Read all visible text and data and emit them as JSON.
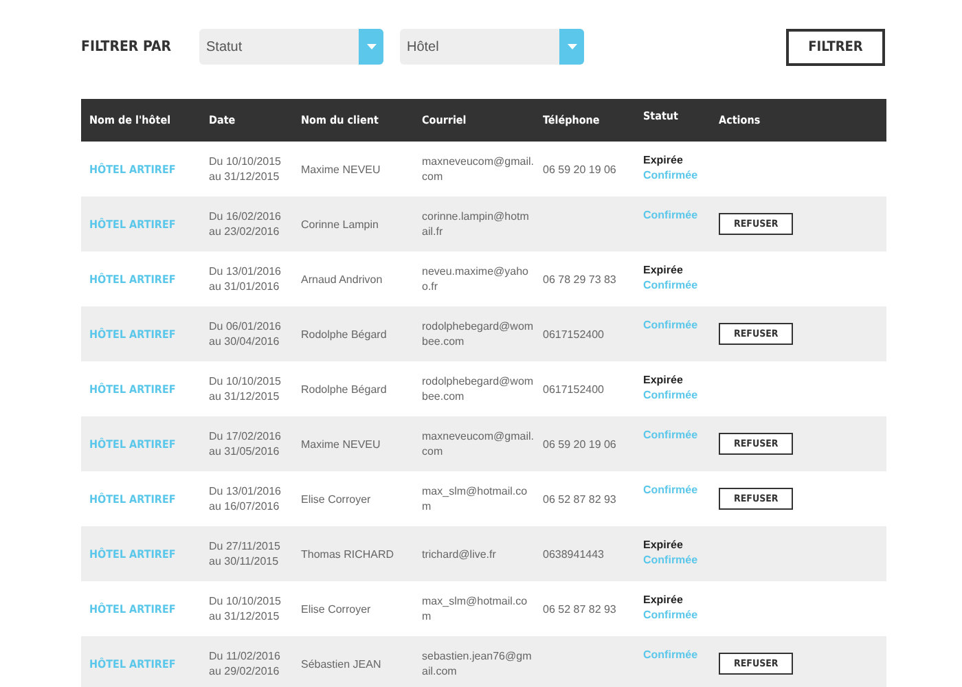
{
  "filter_bar": {
    "label": "FILTRER PAR",
    "selects": [
      {
        "placeholder": "Statut"
      },
      {
        "placeholder": "Hôtel"
      }
    ],
    "button": "FILTRER"
  },
  "table": {
    "columns": [
      "Nom de l'hôtel",
      "Date",
      "Nom du client",
      "Courriel",
      "Téléphone",
      "Statut",
      "Actions"
    ],
    "rows": [
      {
        "hotel": "HÔTEL ARTIREF",
        "date_from": "Du 10/10/2015",
        "date_to": "au 31/12/2015",
        "client": "Maxime NEVEU",
        "email": "maxneveucom@gmail.com",
        "phone": "06 59 20 19 06",
        "statuses": [
          {
            "label": "Expirée",
            "kind": "expired"
          },
          {
            "label": "Confirmée",
            "kind": "confirmed"
          }
        ]
      },
      {
        "hotel": "HÔTEL ARTIREF",
        "date_from": "Du 16/02/2016",
        "date_to": "au 23/02/2016",
        "client": "Corinne Lampin",
        "email": "corinne.lampin@hotmail.fr",
        "statuses": [
          {
            "label": "Confirmée",
            "kind": "confirmed"
          }
        ],
        "action": "REFUSER"
      },
      {
        "hotel": "HÔTEL ARTIREF",
        "date_from": "Du 13/01/2016",
        "date_to": "au 31/01/2016",
        "client": "Arnaud Andrivon",
        "email": "neveu.maxime@yahoo.fr",
        "phone": "06 78 29 73 83",
        "statuses": [
          {
            "label": "Expirée",
            "kind": "expired"
          },
          {
            "label": "Confirmée",
            "kind": "confirmed"
          }
        ]
      },
      {
        "hotel": "HÔTEL ARTIREF",
        "date_from": "Du 06/01/2016",
        "date_to": "au 30/04/2016",
        "client": "Rodolphe Bégard",
        "email": "rodolphebegard@wombee.com",
        "phone": "0617152400",
        "statuses": [
          {
            "label": "Confirmée",
            "kind": "confirmed"
          }
        ],
        "action": "REFUSER"
      },
      {
        "hotel": "HÔTEL ARTIREF",
        "date_from": "Du 10/10/2015",
        "date_to": "au 31/12/2015",
        "client": "Rodolphe Bégard",
        "email": "rodolphebegard@wombee.com",
        "phone": "0617152400",
        "statuses": [
          {
            "label": "Expirée",
            "kind": "expired"
          },
          {
            "label": "Confirmée",
            "kind": "confirmed"
          }
        ]
      },
      {
        "hotel": "HÔTEL ARTIREF",
        "date_from": "Du 17/02/2016",
        "date_to": "au 31/05/2016",
        "client": "Maxime NEVEU",
        "email": "maxneveucom@gmail.com",
        "phone": "06 59 20 19 06",
        "statuses": [
          {
            "label": "Confirmée",
            "kind": "confirmed"
          }
        ],
        "action": "REFUSER"
      },
      {
        "hotel": "HÔTEL ARTIREF",
        "date_from": "Du 13/01/2016",
        "date_to": "au 16/07/2016",
        "client": "Elise Corroyer",
        "email": "max_slm@hotmail.com",
        "phone": "06 52 87 82 93",
        "statuses": [
          {
            "label": "Confirmée",
            "kind": "confirmed"
          }
        ],
        "action": "REFUSER"
      },
      {
        "hotel": "HÔTEL ARTIREF",
        "date_from": "Du 27/11/2015",
        "date_to": "au 30/11/2015",
        "client": "Thomas RICHARD",
        "email": "trichard@live.fr",
        "phone": "0638941443",
        "statuses": [
          {
            "label": "Expirée",
            "kind": "expired"
          },
          {
            "label": "Confirmée",
            "kind": "confirmed"
          }
        ]
      },
      {
        "hotel": "HÔTEL ARTIREF",
        "date_from": "Du 10/10/2015",
        "date_to": "au 31/12/2015",
        "client": "Elise Corroyer",
        "email": "max_slm@hotmail.com",
        "phone": "06 52 87 82 93",
        "statuses": [
          {
            "label": "Expirée",
            "kind": "expired"
          },
          {
            "label": "Confirmée",
            "kind": "confirmed"
          }
        ]
      },
      {
        "hotel": "HÔTEL ARTIREF",
        "date_from": "Du 11/02/2016",
        "date_to": "au 29/02/2016",
        "client": "Sébastien JEAN",
        "email": "sebastien.jean76@gmail.com",
        "statuses": [
          {
            "label": "Confirmée",
            "kind": "confirmed"
          }
        ],
        "action": "REFUSER"
      }
    ]
  }
}
